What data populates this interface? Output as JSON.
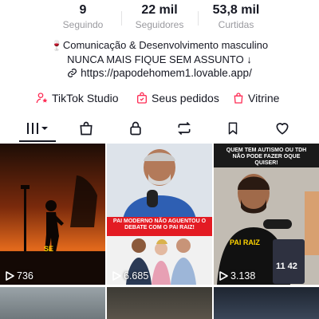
{
  "stats": [
    {
      "value": "9",
      "label": "Seguindo"
    },
    {
      "value": "22 mil",
      "label": "Seguidores"
    },
    {
      "value": "53,8 mil",
      "label": "Curtidas"
    }
  ],
  "bio": {
    "line1_emoji": "🍷",
    "line1": "Comunicação & Desenvolvimento masculino",
    "line2": "NUNCA MAIS FIQUE SEM ASSUNTO ↓",
    "link": "https://papodehomem1.lovable.app/"
  },
  "actions": [
    {
      "label": "TikTok Studio",
      "icon": "person-star-icon"
    },
    {
      "label": "Seus pedidos",
      "icon": "order-bag-icon"
    },
    {
      "label": "Vitrine",
      "icon": "shop-bag-icon"
    }
  ],
  "tabs": [
    {
      "icon": "grid-icon",
      "active": true
    },
    {
      "icon": "shop-bag-icon"
    },
    {
      "icon": "lock-icon"
    },
    {
      "icon": "repost-icon"
    },
    {
      "icon": "bookmark-icon"
    },
    {
      "icon": "heart-icon"
    }
  ],
  "videos": [
    {
      "views": "736",
      "overlay": "SE"
    },
    {
      "views": "6.685",
      "overlay": "PAI MODERNO NÃO AGUENTOU O DEBATE COM O PAI RAIZ!"
    },
    {
      "views": "3.138",
      "overlay": "QUEM TEM AUTISMO OU TDH NÃO PODE FAZER OQUE QUISER!",
      "shirt": "PAI RAIZ",
      "mic": "11 42"
    }
  ],
  "colors": {
    "accent_red": "#fe2c55",
    "text": "#161823",
    "muted": "#9a9a9f"
  }
}
